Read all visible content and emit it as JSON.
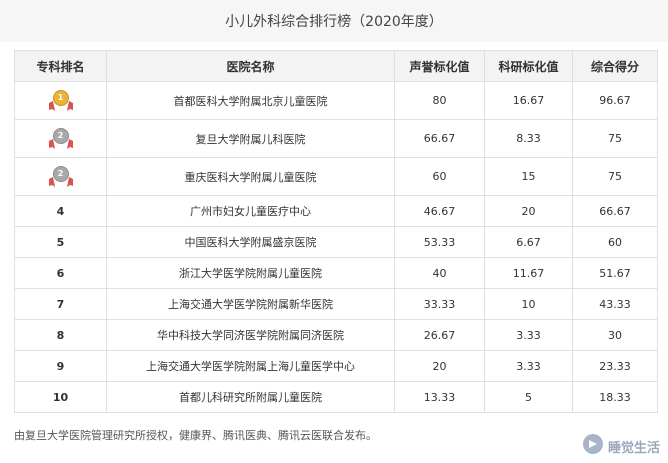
{
  "title": "小儿外科综合排行榜（2020年度）",
  "columns": [
    "专科排名",
    "医院名称",
    "声誉标化值",
    "科研标化值",
    "综合得分"
  ],
  "rows": [
    {
      "rank": "1",
      "name": "首都医科大学附属北京儿童医院",
      "reputation": "80",
      "research": "16.67",
      "score": "96.67"
    },
    {
      "rank": "2",
      "name": "复旦大学附属儿科医院",
      "reputation": "66.67",
      "research": "8.33",
      "score": "75"
    },
    {
      "rank": "2",
      "name": "重庆医科大学附属儿童医院",
      "reputation": "60",
      "research": "15",
      "score": "75"
    },
    {
      "rank": "4",
      "name": "广州市妇女儿童医疗中心",
      "reputation": "46.67",
      "research": "20",
      "score": "66.67"
    },
    {
      "rank": "5",
      "name": "中国医科大学附属盛京医院",
      "reputation": "53.33",
      "research": "6.67",
      "score": "60"
    },
    {
      "rank": "6",
      "name": "浙江大学医学院附属儿童医院",
      "reputation": "40",
      "research": "11.67",
      "score": "51.67"
    },
    {
      "rank": "7",
      "name": "上海交通大学医学院附属新华医院",
      "reputation": "33.33",
      "research": "10",
      "score": "43.33"
    },
    {
      "rank": "8",
      "name": "华中科技大学同济医学院附属同济医院",
      "reputation": "26.67",
      "research": "3.33",
      "score": "30"
    },
    {
      "rank": "9",
      "name": "上海交通大学医学院附属上海儿童医学中心",
      "reputation": "20",
      "research": "3.33",
      "score": "23.33"
    },
    {
      "rank": "10",
      "name": "首都儿科研究所附属儿童医院",
      "reputation": "13.33",
      "research": "5",
      "score": "18.33"
    }
  ],
  "footnote": "由复旦大学医院管理研究所授权，健康界、腾讯医典、腾讯云医联合发布。",
  "watermark": "睡觉生活",
  "colors": {
    "gold": "#e9b43a",
    "silver": "#a9a9a9",
    "ribbon": "#d9534f"
  }
}
